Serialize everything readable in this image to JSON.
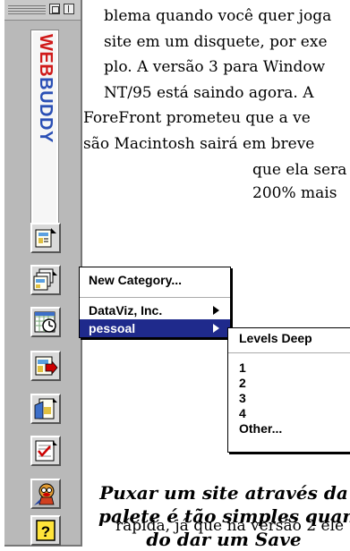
{
  "article": {
    "lines": [
      "blema quando você quer joga",
      "site em um disquete, por exe",
      "plo. A versão 3 para Window",
      "NT/95 está saindo agora. A",
      "ForeFront prometeu que a ve",
      "são Macintosh sairá em breve",
      "que ela sera",
      "200% mais",
      "rápida, já que na versão 2 ele"
    ],
    "caption": [
      "Puxar um site através da",
      "palete é tão simples quan-",
      "do dar um Save"
    ]
  },
  "palette": {
    "logo_web": "WEB",
    "logo_buddy": "BUDDY",
    "buttons": [
      {
        "name": "capture-page-icon"
      },
      {
        "name": "capture-site-icon"
      },
      {
        "name": "schedule-icon"
      },
      {
        "name": "export-icon"
      },
      {
        "name": "import-icon"
      },
      {
        "name": "checklist-icon"
      },
      {
        "name": "buddy-mascot-icon"
      },
      {
        "name": "help-icon"
      }
    ]
  },
  "menu1": {
    "new_category": "New Category...",
    "items": [
      "DataViz, Inc.",
      "pessoal"
    ],
    "selected": "pessoal"
  },
  "menu2": {
    "header": "Levels Deep",
    "items": [
      "1",
      "2",
      "3",
      "4",
      "Other..."
    ]
  },
  "colors": {
    "menu_highlight": "#1f2a8c",
    "logo_red": "#d01a1a",
    "logo_blue": "#2a4fb5"
  }
}
